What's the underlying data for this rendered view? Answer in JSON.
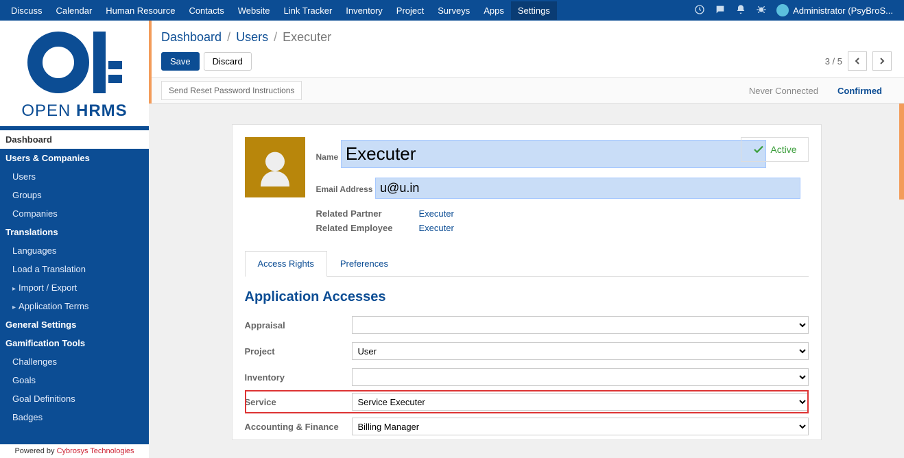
{
  "topmenu": {
    "items": [
      "Discuss",
      "Calendar",
      "Human Resource",
      "Contacts",
      "Website",
      "Link Tracker",
      "Inventory",
      "Project",
      "Surveys",
      "Apps",
      "Settings"
    ],
    "active_index": 10,
    "user_label": "Administrator (PsyBroS..."
  },
  "logo": {
    "line1": "OPEN ",
    "line2": "HRMS"
  },
  "sidebar": {
    "groups": [
      {
        "label": "Dashboard",
        "active": true,
        "items": []
      },
      {
        "label": "Users & Companies",
        "items": [
          "Users",
          "Groups",
          "Companies"
        ]
      },
      {
        "label": "Translations",
        "items": [
          "Languages",
          "Load a Translation",
          "Import / Export",
          "Application Terms"
        ],
        "expandable_from": 2
      },
      {
        "label": "General Settings",
        "items": []
      },
      {
        "label": "Gamification Tools",
        "items": [
          "Challenges",
          "Goals",
          "Goal Definitions",
          "Badges"
        ]
      }
    ],
    "powered_prefix": "Powered by ",
    "powered_link": "Cybrosys Technologies"
  },
  "breadcrumb": {
    "a": "Dashboard",
    "b": "Users",
    "current": "Executer"
  },
  "buttons": {
    "save": "Save",
    "discard": "Discard"
  },
  "pager": {
    "text": "3 / 5"
  },
  "subhead": {
    "reset": "Send Reset Password Instructions",
    "never": "Never Connected",
    "confirmed": "Confirmed"
  },
  "form": {
    "name_label": "Name",
    "name_value": "Executer",
    "email_label": "Email Address",
    "email_value": "u@u.in",
    "status": "Active",
    "rel_partner_label": "Related Partner",
    "rel_partner_value": "Executer",
    "rel_emp_label": "Related Employee",
    "rel_emp_value": "Executer"
  },
  "tabs": {
    "a": "Access Rights",
    "b": "Preferences"
  },
  "section_title": "Application Accesses",
  "access": {
    "rows": [
      {
        "label": "Appraisal",
        "value": ""
      },
      {
        "label": "Project",
        "value": "User"
      },
      {
        "label": "Inventory",
        "value": ""
      },
      {
        "label": "Service",
        "value": "Service Executer",
        "highlight": true
      },
      {
        "label": "Accounting & Finance",
        "value": "Billing Manager"
      }
    ]
  }
}
